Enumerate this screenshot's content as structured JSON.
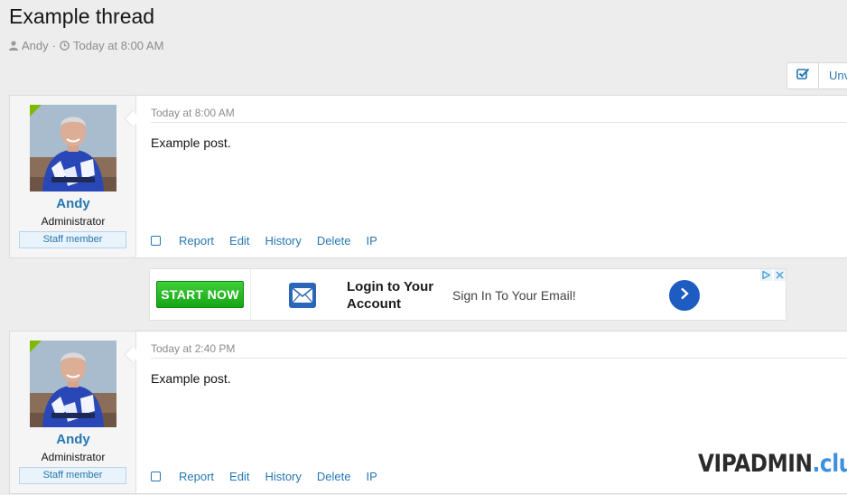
{
  "thread": {
    "title": "Example thread",
    "author": "Andy",
    "separator": "·",
    "date": "Today at 8:00 AM"
  },
  "toolbar": {
    "select_icon": "checkbox-icon",
    "partial_label": "Unv"
  },
  "posts": [
    {
      "user": {
        "name": "Andy",
        "title": "Administrator",
        "badge": "Staff member",
        "online": true
      },
      "date": "Today at 8:00 AM",
      "body": "Example post.",
      "actions": [
        "Report",
        "Edit",
        "History",
        "Delete",
        "IP"
      ]
    },
    {
      "user": {
        "name": "Andy",
        "title": "Administrator",
        "badge": "Staff member",
        "online": true
      },
      "date": "Today at 2:40 PM",
      "body": "Example post.",
      "actions": [
        "Report",
        "Edit",
        "History",
        "Delete",
        "IP"
      ]
    }
  ],
  "ad": {
    "cta": "START NOW",
    "headline": "Login to Your Account",
    "subtext": "Sign In To Your Email!",
    "icons": [
      "mail-icon",
      "chevron-right-icon",
      "adchoices-icon",
      "close-icon"
    ]
  },
  "watermark": {
    "part1": "VIPADMIN",
    "part2": ".club"
  },
  "colors": {
    "link": "#2577b1",
    "online": "#7fb900",
    "cta_green": "#17a515",
    "ad_button": "#1f5cc2",
    "watermark_accent": "#3d8fe0"
  }
}
